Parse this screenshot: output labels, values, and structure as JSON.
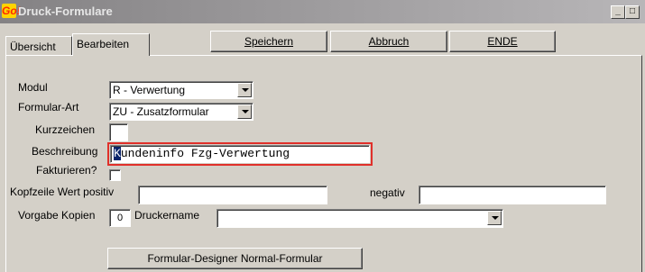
{
  "window": {
    "title": "Druck-Formulare",
    "logo_text": "Go!",
    "min_symbol": "_",
    "max_symbol": "□"
  },
  "tabs": [
    {
      "label": "Übersicht",
      "active": false
    },
    {
      "label": "Bearbeiten",
      "active": true
    }
  ],
  "toolbar": {
    "save_label": "Speichern",
    "cancel_label": "Abbruch",
    "end_label": "ENDE"
  },
  "form": {
    "modul_label": "Modul",
    "modul_value": "R - Verwertung",
    "formularart_label": "Formular-Art",
    "formularart_value": "ZU - Zusatzformular",
    "kurzzeichen_label": "Kurzzeichen",
    "kurzzeichen_value": "",
    "beschreibung_label": "Beschreibung",
    "beschreibung_first": "K",
    "beschreibung_rest": "undeninfo Fzg-Verwertung",
    "fakturieren_label": "Fakturieren?",
    "kopfzeile_label": "Kopfzeile Wert positiv",
    "kopfzeile_value": "",
    "negativ_label": "negativ",
    "negativ_value": "",
    "kopien_label": "Vorgabe Kopien",
    "kopien_value": "0",
    "drucker_label": "Druckername",
    "drucker_value": "",
    "designer_button": "Formular-Designer Normal-Formular"
  },
  "colors": {
    "focus_border": "#e0302a",
    "selection": "#0a246a"
  }
}
